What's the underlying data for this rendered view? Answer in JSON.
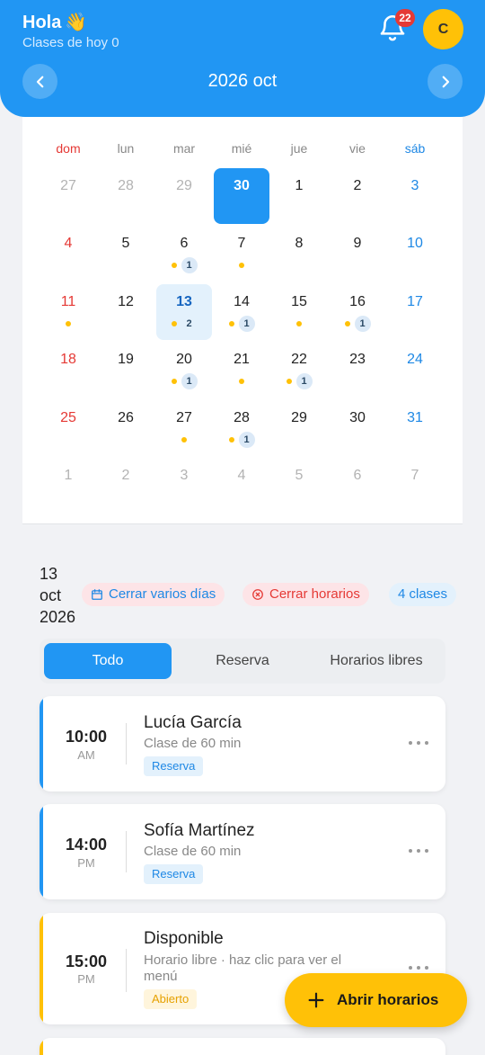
{
  "header": {
    "greeting": "Hola",
    "wave": "👋",
    "subtitle": "Clases de hoy 0",
    "notification_count": "22",
    "avatar_initial": "C",
    "month_title": "2026 oct",
    "color": "#2196f3"
  },
  "calendar": {
    "weekdays": [
      "dom",
      "lun",
      "mar",
      "mié",
      "jue",
      "vie",
      "sáb"
    ],
    "weeks": [
      [
        {
          "day": "27",
          "muted": true
        },
        {
          "day": "28",
          "muted": true
        },
        {
          "day": "29",
          "muted": true
        },
        {
          "day": "30",
          "today": true
        },
        {
          "day": "1"
        },
        {
          "day": "2"
        },
        {
          "day": "3"
        }
      ],
      [
        {
          "day": "4"
        },
        {
          "day": "5"
        },
        {
          "day": "6",
          "dot": true,
          "count": "1"
        },
        {
          "day": "7",
          "dot": true
        },
        {
          "day": "8"
        },
        {
          "day": "9"
        },
        {
          "day": "10"
        }
      ],
      [
        {
          "day": "11",
          "dot": true
        },
        {
          "day": "12"
        },
        {
          "day": "13",
          "selected": true,
          "dot": true,
          "count": "2"
        },
        {
          "day": "14",
          "dot": true,
          "count": "1"
        },
        {
          "day": "15",
          "dot": true
        },
        {
          "day": "16",
          "dot": true,
          "count": "1"
        },
        {
          "day": "17"
        }
      ],
      [
        {
          "day": "18"
        },
        {
          "day": "19"
        },
        {
          "day": "20",
          "dot": true,
          "count": "1"
        },
        {
          "day": "21",
          "dot": true
        },
        {
          "day": "22",
          "dot": true,
          "count": "1"
        },
        {
          "day": "23"
        },
        {
          "day": "24"
        }
      ],
      [
        {
          "day": "25"
        },
        {
          "day": "26"
        },
        {
          "day": "27",
          "dot": true
        },
        {
          "day": "28",
          "dot": true,
          "count": "1"
        },
        {
          "day": "29"
        },
        {
          "day": "30"
        },
        {
          "day": "31"
        }
      ],
      [
        {
          "day": "1",
          "muted": true
        },
        {
          "day": "2",
          "muted": true
        },
        {
          "day": "3",
          "muted": true
        },
        {
          "day": "4",
          "muted": true
        },
        {
          "day": "5",
          "muted": true
        },
        {
          "day": "6",
          "muted": true
        },
        {
          "day": "7",
          "muted": true
        }
      ]
    ]
  },
  "day": {
    "title_line1": "13",
    "title_line2": "oct",
    "title_line3": "2026",
    "close_days_label": "Cerrar varios días",
    "close_hours_label": "Cerrar horarios",
    "class_count_label": "4 clases"
  },
  "tabs": [
    "Todo",
    "Reserva",
    "Horarios libres"
  ],
  "classes": [
    {
      "time": "10:00",
      "ampm": "AM",
      "name": "Lucía García",
      "detail": "Clase de 60 min",
      "tag": "Reserva",
      "kind": "reserva"
    },
    {
      "time": "14:00",
      "ampm": "PM",
      "name": "Sofía Martínez",
      "detail": "Clase de 60 min",
      "tag": "Reserva",
      "kind": "reserva"
    },
    {
      "time": "15:00",
      "ampm": "PM",
      "name": "Disponible",
      "detail": "Horario libre · haz clic para ver el menú",
      "tag": "Abierto",
      "kind": "abierto"
    }
  ],
  "fab": {
    "label": "Abrir horarios"
  },
  "colors": {
    "primary": "#2196f3",
    "accent": "#ffc107",
    "sunday": "#e53935",
    "saturday": "#1e88e5"
  }
}
